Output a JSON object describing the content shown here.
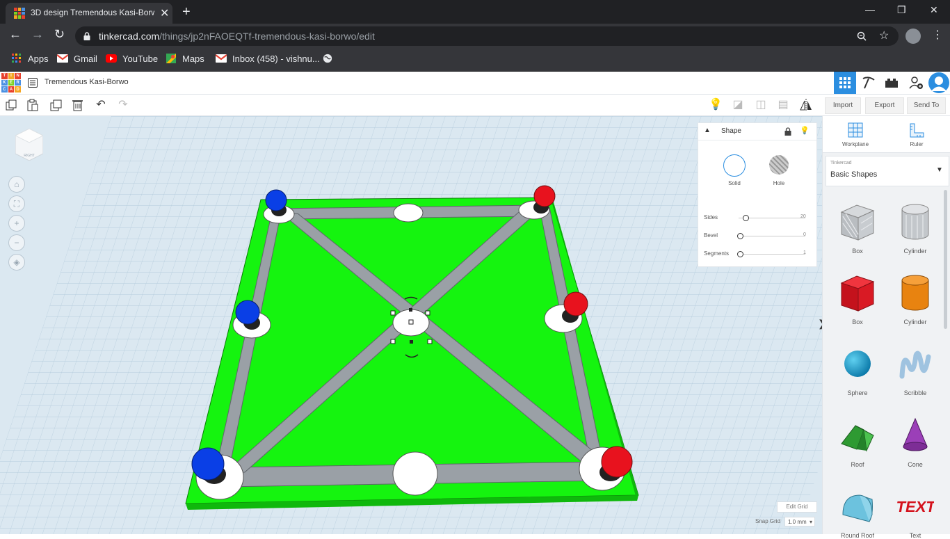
{
  "browser": {
    "tab_title": "3D design Tremendous Kasi-Borw",
    "url_host": "tinkercad.com",
    "url_path": "/things/jp2nFAOEQTf-tremendous-kasi-borwo/edit",
    "bookmarks": [
      {
        "label": "Apps",
        "icon": "apps-grid-icon"
      },
      {
        "label": "Gmail",
        "icon": "gmail-icon"
      },
      {
        "label": "YouTube",
        "icon": "youtube-icon"
      },
      {
        "label": "Maps",
        "icon": "maps-icon"
      },
      {
        "label": "Inbox (458) - vishnu...",
        "icon": "gmail-icon"
      },
      {
        "label": "",
        "icon": "globe-icon"
      }
    ]
  },
  "app": {
    "logo_letters": [
      "T",
      "I",
      "N",
      "K",
      "E",
      "R",
      "C",
      "A",
      "D"
    ],
    "project_title": "Tremendous Kasi-Borwo",
    "actions": {
      "import": "Import",
      "export": "Export",
      "send_to": "Send To"
    }
  },
  "viewcube": {
    "face_label": "RIGHT"
  },
  "shape_panel": {
    "title": "Shape",
    "solid_label": "Solid",
    "hole_label": "Hole",
    "properties": [
      {
        "label": "Sides",
        "value": "20",
        "level": 0.09
      },
      {
        "label": "Bevel",
        "value": "0",
        "level": 0.0
      },
      {
        "label": "Segments",
        "value": "1",
        "level": 0.0
      }
    ]
  },
  "library": {
    "workplane_label": "Workplane",
    "ruler_label": "Ruler",
    "category_source": "Tinkercad",
    "category": "Basic Shapes",
    "shapes": [
      {
        "label": "Box",
        "icon": "box-hole-icon"
      },
      {
        "label": "Cylinder",
        "icon": "cylinder-hole-icon"
      },
      {
        "label": "Box",
        "icon": "box-red-icon"
      },
      {
        "label": "Cylinder",
        "icon": "cylinder-orange-icon"
      },
      {
        "label": "Sphere",
        "icon": "sphere-icon"
      },
      {
        "label": "Scribble",
        "icon": "scribble-icon"
      },
      {
        "label": "Roof",
        "icon": "roof-icon"
      },
      {
        "label": "Cone",
        "icon": "cone-icon"
      },
      {
        "label": "Round Roof",
        "icon": "round-roof-icon"
      },
      {
        "label": "Text",
        "icon": "text-shape-icon"
      }
    ]
  },
  "grid": {
    "edit_grid": "Edit Grid",
    "snap_label": "Snap Grid",
    "snap_value": "1.0 mm"
  },
  "colors": {
    "board_green": "#15f40f",
    "track_gray": "#9aa0a6",
    "piece_blue": "#0a3fe6",
    "piece_red": "#e8121e",
    "accent": "#2b8ee0"
  }
}
